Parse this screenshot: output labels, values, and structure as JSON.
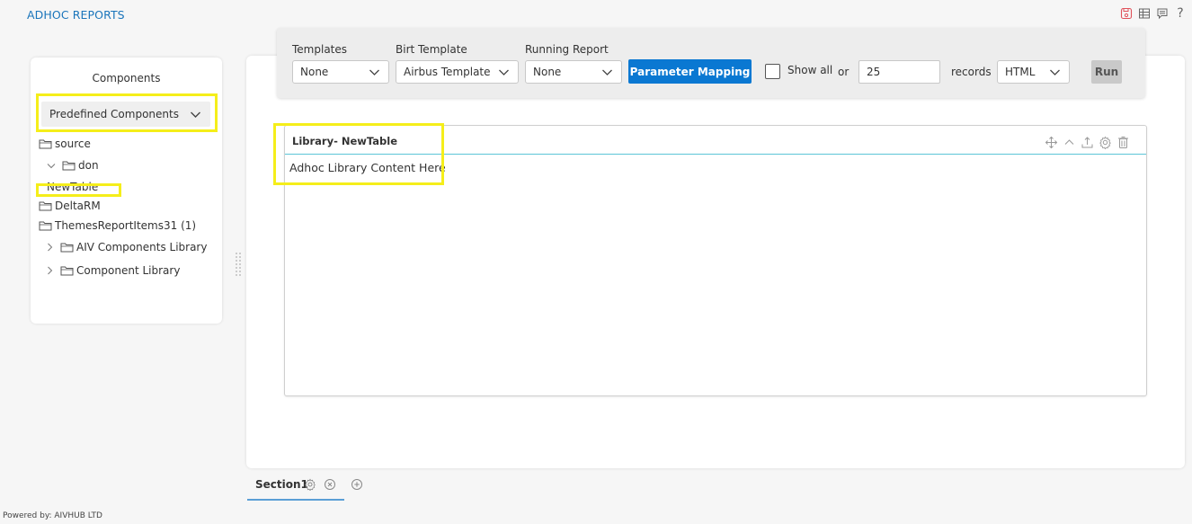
{
  "app": {
    "title": "ADHOC REPORTS",
    "top_icons": [
      "save-icon",
      "table-icon",
      "comment-icon",
      "help-icon"
    ],
    "help_glyph": "?"
  },
  "components_panel": {
    "title": "Components",
    "dropdown": {
      "selected": "Predefined Components"
    },
    "tree": [
      {
        "label": "source",
        "icon": "folder-icon",
        "level": 0,
        "expander": null
      },
      {
        "label": "don",
        "icon": "folder-icon",
        "level": 1,
        "expander": "expanded"
      },
      {
        "label": "NewTable",
        "icon": null,
        "level": 0,
        "expander": null
      },
      {
        "label": "DeltaRM",
        "icon": "folder-icon",
        "level": 0,
        "expander": null
      },
      {
        "label": "ThemesReportItems31 (1)",
        "icon": "folder-icon",
        "level": 0,
        "expander": null
      },
      {
        "label": "AIV Components Library",
        "icon": "folder-icon",
        "level": 1,
        "expander": "collapsed"
      },
      {
        "label": "Component Library",
        "icon": "folder-icon",
        "level": 1,
        "expander": "collapsed"
      }
    ]
  },
  "toolbar": {
    "templates_label": "Templates",
    "templates_value": "None",
    "birt_label": "Birt Template",
    "birt_value": "Airbus Template",
    "running_label": "Running Report",
    "running_value": "None",
    "parameter_mapping_label": "Parameter Mapping",
    "show_all_label": "Show all",
    "show_all_checked": false,
    "or_label": "or",
    "records_value": "25",
    "records_label": "records",
    "format_value": "HTML",
    "run_label": "Run"
  },
  "widget": {
    "title": "Library- NewTable",
    "content": "Adhoc Library Content Here",
    "tools": [
      "move-icon",
      "collapse-icon",
      "export-icon",
      "settings-icon",
      "delete-icon"
    ]
  },
  "sections": {
    "tabs": [
      {
        "label": "Section1",
        "active": true
      }
    ]
  },
  "footer": {
    "text": "Powered by: AIVHUB LTD"
  },
  "colors": {
    "brand": "#1a75bb",
    "primary_button": "#0a78d2",
    "highlight": "#f5ee1a",
    "widget_divider": "#5cc5d7",
    "save_icon": "#e0515a"
  }
}
